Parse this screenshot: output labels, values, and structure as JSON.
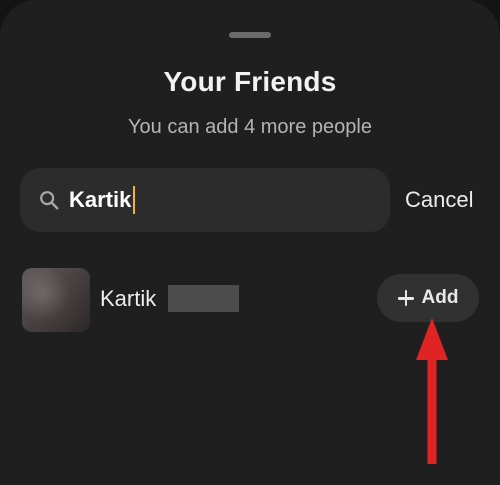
{
  "sheet": {
    "title": "Your Friends",
    "subtitle": "You can add 4 more people"
  },
  "search": {
    "value": "Kartik",
    "cancel_label": "Cancel",
    "icon": "search-icon"
  },
  "results": [
    {
      "name": "Kartik",
      "add_label": "Add",
      "add_icon": "plus-icon"
    }
  ],
  "colors": {
    "background": "#1f1f1f",
    "field": "#2c2c2c",
    "caret": "#f2b630",
    "annotation_arrow": "#e02424"
  }
}
